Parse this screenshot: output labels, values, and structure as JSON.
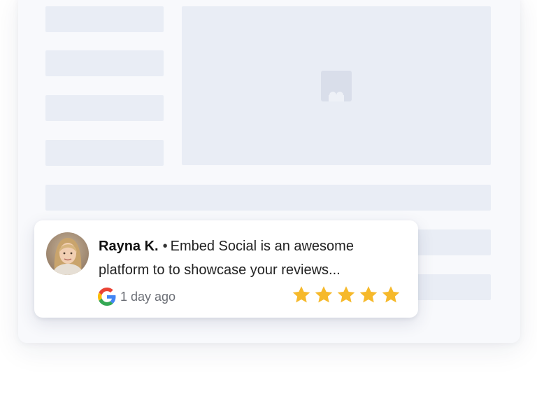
{
  "review": {
    "author": "Rayna K.",
    "separator": "•",
    "text": "Embed Social is an awesome platform to to showcase your reviews...",
    "time_ago": "1 day ago",
    "rating": 5,
    "rating_max": 5,
    "source_icon": "google-icon",
    "avatar_icon": "user-photo"
  },
  "colors": {
    "star": "#f6b92b",
    "skeleton": "#e9edf5",
    "page_background": "#f8f9fc",
    "google_blue": "#4285F4",
    "google_red": "#EA4335",
    "google_yellow": "#FBBC05",
    "google_green": "#34A853"
  }
}
